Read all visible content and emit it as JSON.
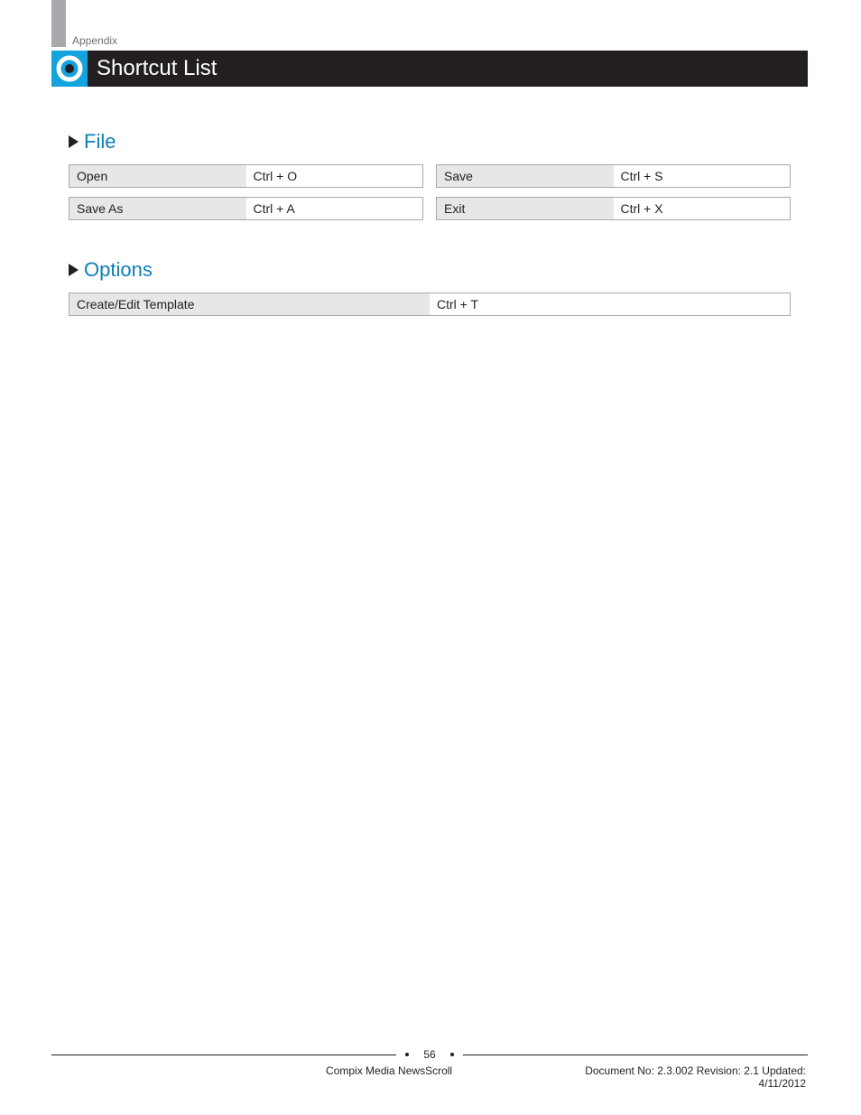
{
  "header": {
    "breadcrumb": "Appendix",
    "title": "Shortcut List"
  },
  "sections": {
    "file": {
      "heading": "File",
      "rows": [
        [
          {
            "name": "Open",
            "key": "Ctrl + O"
          },
          {
            "name": "Save",
            "key": "Ctrl + S"
          }
        ],
        [
          {
            "name": "Save As",
            "key": "Ctrl + A"
          },
          {
            "name": "Exit",
            "key": "Ctrl + X"
          }
        ]
      ]
    },
    "options": {
      "heading": "Options",
      "rows": [
        [
          {
            "name": "Create/Edit Template",
            "key": "Ctrl + T"
          }
        ]
      ]
    }
  },
  "footer": {
    "page": "56",
    "product": "Compix Media NewsScroll",
    "docinfo": "Document No: 2.3.002 Revision: 2.1 Updated: 4/11/2012"
  }
}
